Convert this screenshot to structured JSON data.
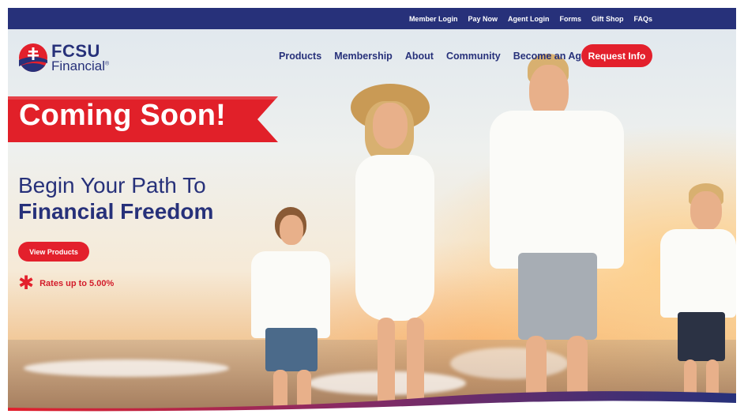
{
  "top_nav": {
    "links": [
      "Member Login",
      "Pay Now",
      "Agent Login",
      "Forms",
      "Gift Shop",
      "FAQs"
    ]
  },
  "logo": {
    "brand": "FCSU",
    "subtitle": "Financial",
    "registered": "®",
    "icon": "cross-globe-icon"
  },
  "main_nav": {
    "items": [
      "Products",
      "Membership",
      "About",
      "Community",
      "Become an Agent"
    ],
    "cta_label": "Request Info"
  },
  "hero": {
    "banner_text": "Coming Soon!",
    "headline_line1": "Begin Your Path To",
    "headline_line2": "Financial Freedom",
    "button_label": "View Products",
    "rates_icon": "asterisk-icon",
    "rates_text": "Rates up to 5.00%"
  },
  "colors": {
    "navy": "#27317a",
    "red": "#e3202c",
    "ribbon_red": "#e12029",
    "white": "#ffffff"
  }
}
